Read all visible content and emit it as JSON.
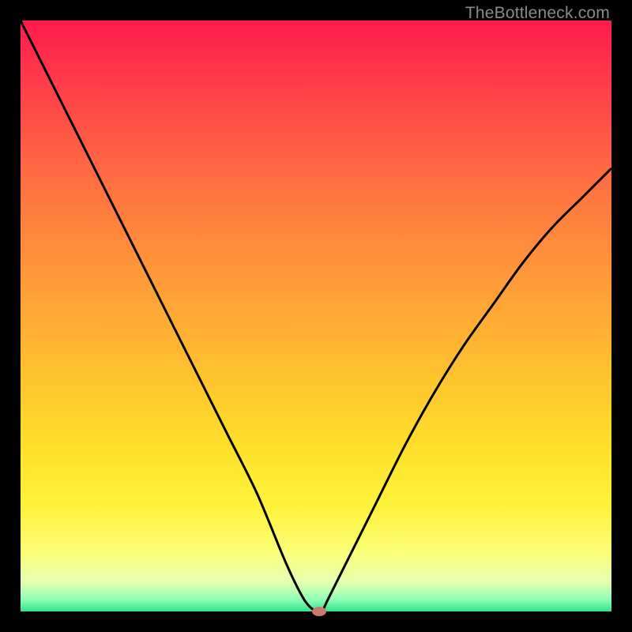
{
  "watermark": "TheBottleneck.com",
  "chart_data": {
    "type": "line",
    "title": "",
    "xlabel": "",
    "ylabel": "",
    "xlim": [
      0,
      100
    ],
    "ylim": [
      0,
      100
    ],
    "grid": false,
    "legend": false,
    "series": [
      {
        "name": "bottleneck-curve",
        "x": [
          0,
          5,
          10,
          15,
          20,
          25,
          30,
          35,
          40,
          45,
          48,
          50,
          51,
          52,
          55,
          60,
          65,
          70,
          75,
          80,
          85,
          90,
          95,
          100
        ],
        "y": [
          100,
          90,
          80,
          70,
          60,
          50,
          40,
          30,
          20,
          8,
          2,
          0,
          0,
          2,
          8,
          18,
          28,
          37,
          45,
          52,
          59,
          65,
          70,
          75
        ]
      }
    ],
    "marker": {
      "x": 50.5,
      "y": 0
    },
    "background_gradient": {
      "stops": [
        {
          "pos": 0.0,
          "color": "#ff1a4d"
        },
        {
          "pos": 0.35,
          "color": "#ff843d"
        },
        {
          "pos": 0.72,
          "color": "#ffdf2b"
        },
        {
          "pos": 0.95,
          "color": "#e5ffb0"
        },
        {
          "pos": 1.0,
          "color": "#33e28a"
        }
      ]
    }
  }
}
